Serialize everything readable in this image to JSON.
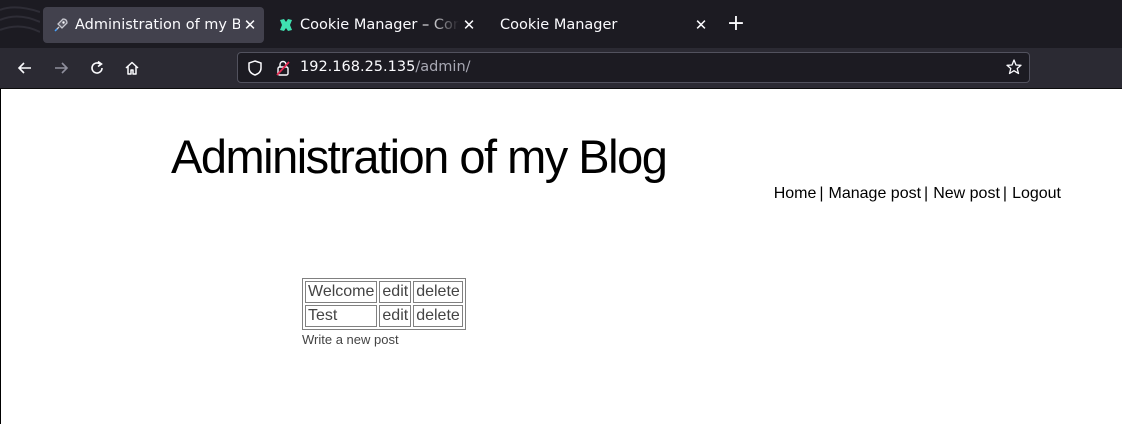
{
  "browser": {
    "tabs": [
      {
        "title": "Administration of my Blog",
        "active": true,
        "favicon": "rocket-icon"
      },
      {
        "title": "Cookie Manager – Consign",
        "active": false,
        "favicon": "cookie-manager-icon"
      },
      {
        "title": "Cookie Manager",
        "active": false,
        "favicon": ""
      }
    ],
    "close_glyph": "✕",
    "new_tab_glyph": "+",
    "url_host": "192.168.25.135",
    "url_path": "/admin/"
  },
  "page": {
    "title": "Administration of my Blog",
    "nav": [
      {
        "label": "Home"
      },
      {
        "label": "Manage post"
      },
      {
        "label": "New post"
      },
      {
        "label": "Logout"
      }
    ],
    "nav_separator": "|",
    "posts": [
      {
        "title": "Welcome",
        "edit": "edit",
        "delete": "delete"
      },
      {
        "title": "Test",
        "edit": "edit",
        "delete": "delete"
      }
    ],
    "new_post_link": "Write a new post"
  },
  "colors": {
    "tabbar_bg": "#1c1b22",
    "toolbar_bg": "#2b2a33",
    "active_tab_bg": "#42414d",
    "cookie_icon": "#3fe1b0",
    "lock_warning": "#e22850"
  }
}
